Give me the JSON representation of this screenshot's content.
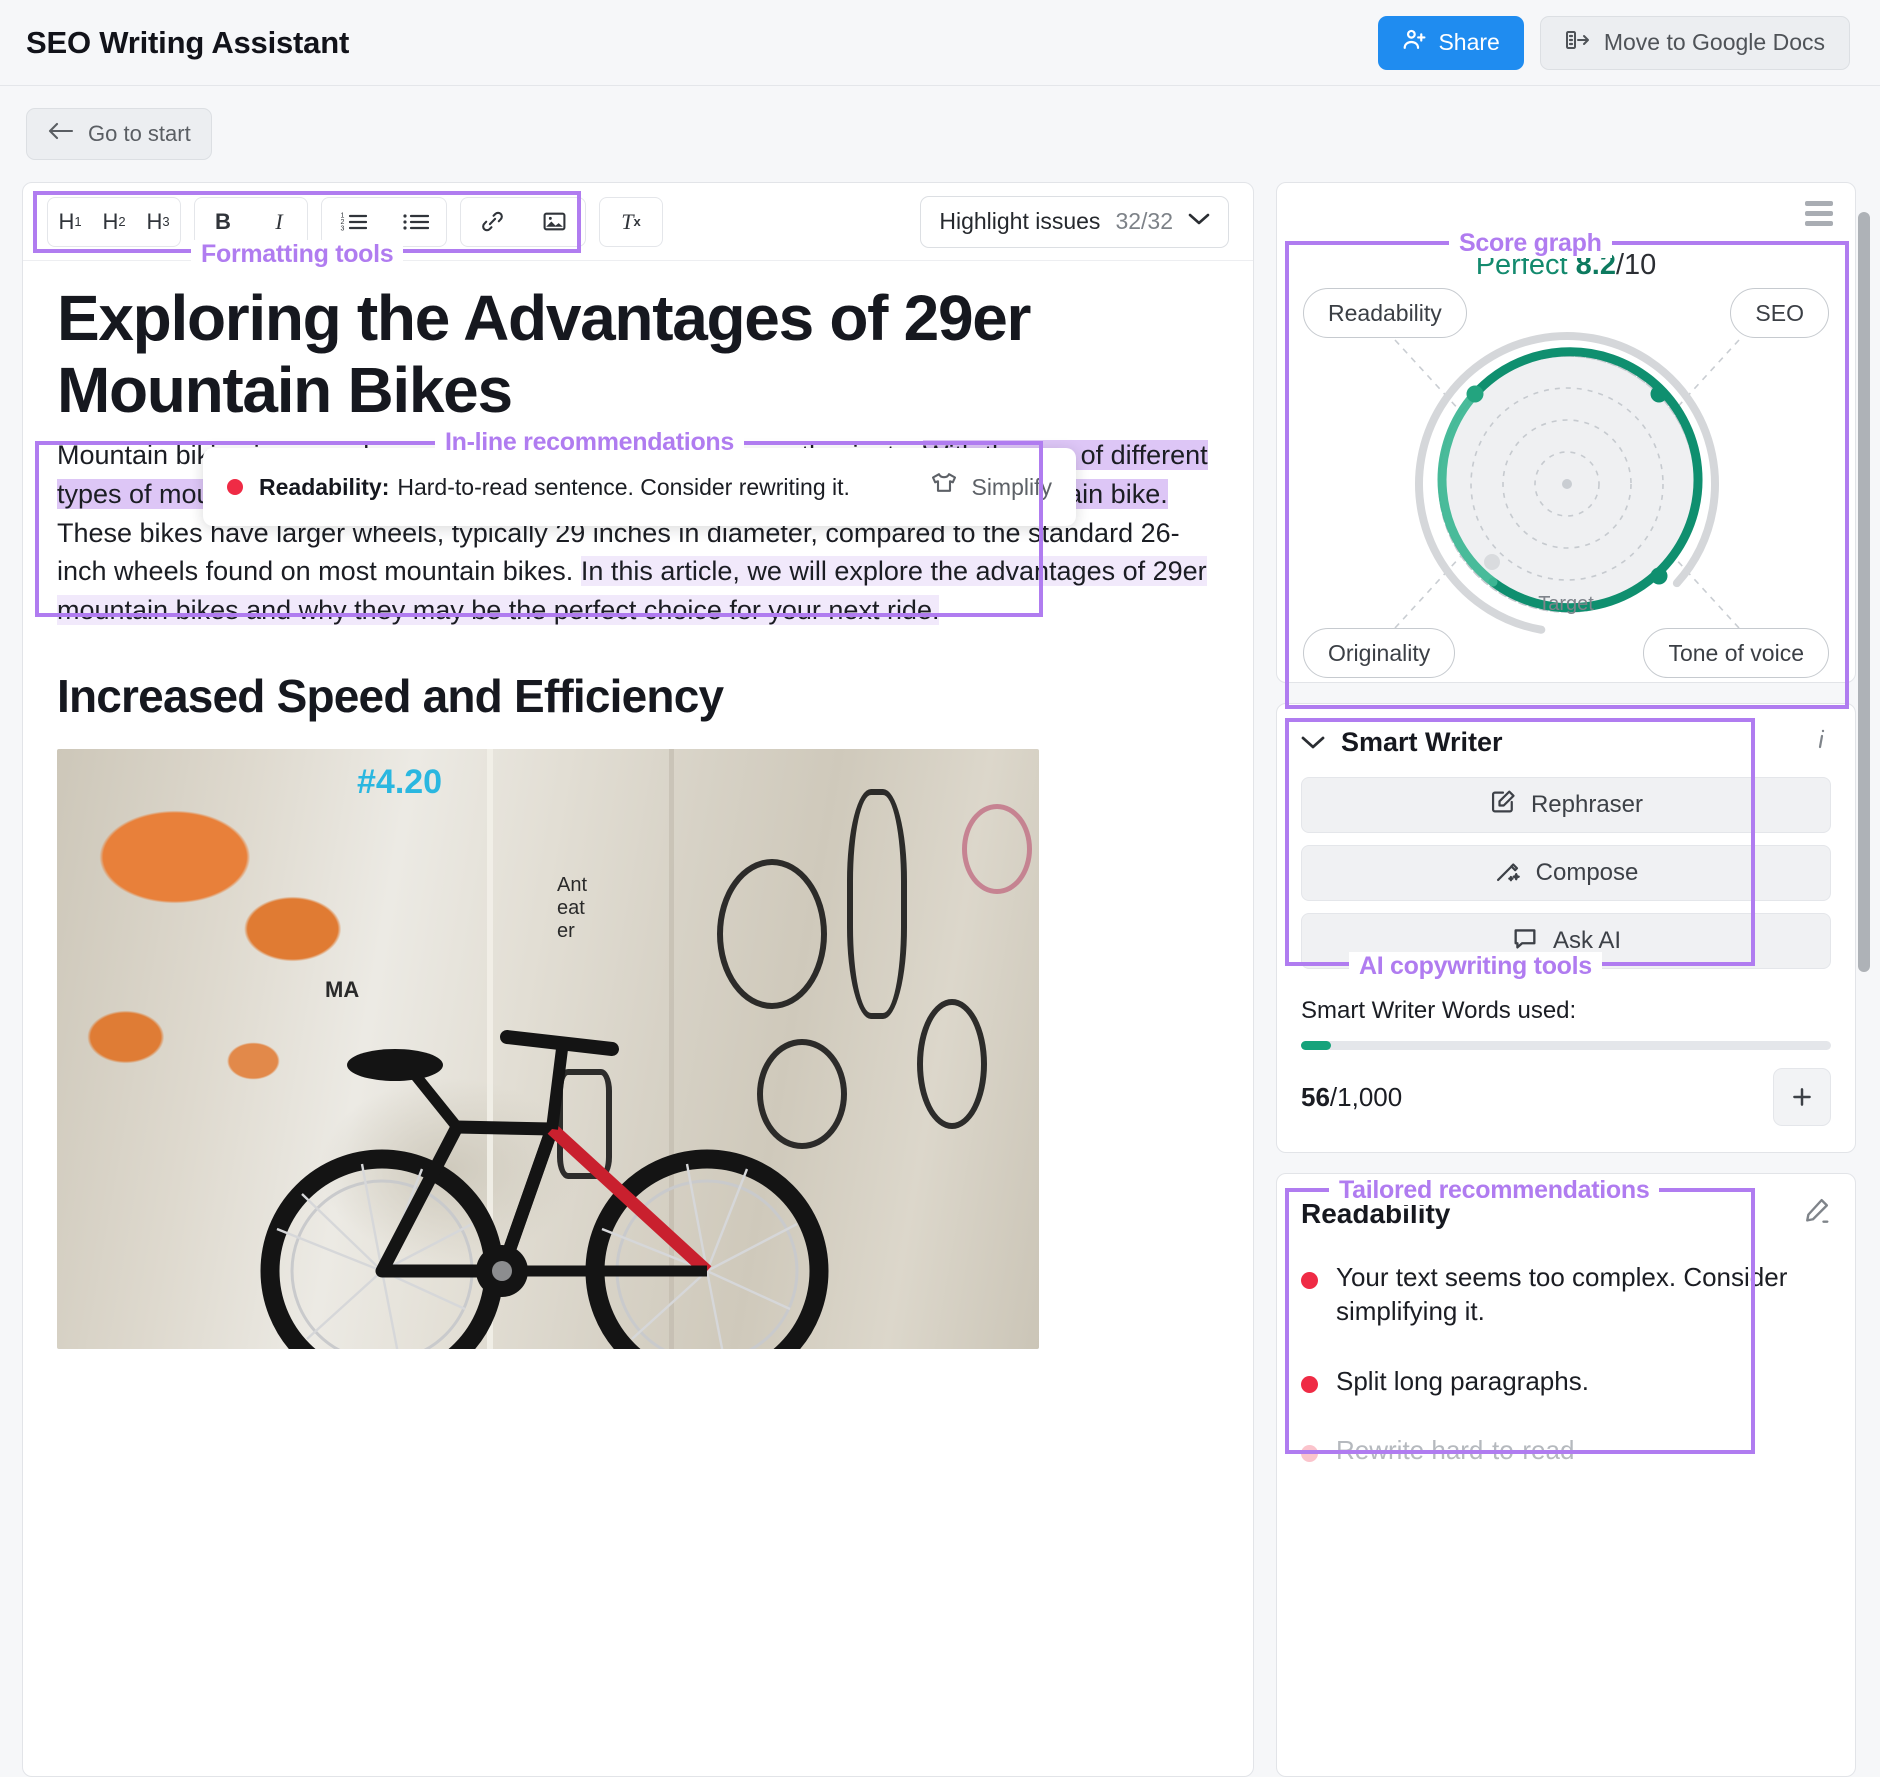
{
  "app": {
    "title": "SEO Writing Assistant"
  },
  "topbar": {
    "share_label": "Share",
    "share_icon": "person-add-icon",
    "docs_label": "Move to Google Docs",
    "docs_icon": "move-to-docs-icon",
    "accent_blue": "#1f8cf0"
  },
  "nav": {
    "back_label": "Go to start",
    "back_icon": "arrow-left-icon"
  },
  "editor": {
    "formatting": {
      "group1": [
        "H1",
        "H2",
        "H3"
      ],
      "group2": [
        "B",
        "I"
      ],
      "group3": [
        "ordered-list-icon",
        "bulleted-list-icon"
      ],
      "group4": [
        "link-icon",
        "image-icon"
      ],
      "group5": [
        "clear-formatting-icon"
      ],
      "h1": "H",
      "h1sub": "1",
      "h2": "H",
      "h2sub": "2",
      "h3": "H",
      "h3sub": "3",
      "bold": "B",
      "italic": "I",
      "clear": "T",
      "clearsub": "x"
    },
    "highlight": {
      "label": "Highlight issues",
      "count": "32/32",
      "chevron": "chevron-down-icon"
    },
    "document": {
      "title": "Exploring the Advantages of 29er Mountain Bikes",
      "p1_a": "Mountain ",
      "p1_hidden": "biking is a popular sport enjoyed by many outdoor",
      "p1_b": "enthusiasts. ",
      "p1_strong": "With the rise of different types of mountain bikes, one type that has gained a lot of attention is the 29er mountain bike.",
      "p1_c": " These bikes have larger wheels, typically 29 inches in diameter, compared to the standard 26-inch wheels found on most mountain bikes. ",
      "p1_soft": "In this article, we will explore the advantages of 29er mountain bikes and why they may be the perfect choice for your next ride.",
      "h2": "Increased Speed and Efficiency",
      "photo_alt": "mountain-bike-against-graffiti-wall-photo"
    },
    "recommendation": {
      "category": "Readability:",
      "message": "Hard-to-read sentence. Consider rewriting it.",
      "action_label": "Simplify",
      "action_icon": "simplify-shirt-icon",
      "dot_color": "#ef2b45"
    }
  },
  "sidebar": {
    "menu_icon": "hamburger-menu-icon",
    "score": {
      "status": "Perfect",
      "value": "8.2",
      "denominator": "/10",
      "target_label": "Target",
      "metrics": [
        "Readability",
        "SEO",
        "Originality",
        "Tone of voice"
      ],
      "accent_green": "#0f8f6f"
    },
    "smart_writer": {
      "title": "Smart Writer",
      "chevron": "chevron-down-icon",
      "info_icon": "info-icon",
      "buttons": [
        {
          "label": "Rephraser",
          "icon": "edit-square-icon"
        },
        {
          "label": "Compose",
          "icon": "magic-wand-icon"
        },
        {
          "label": "Ask AI",
          "icon": "chat-bubble-icon"
        }
      ],
      "words_label": "Smart Writer Words used:",
      "used": "56",
      "limit": "/1,000",
      "progress_percent": 5.6,
      "add_icon": "plus-icon"
    },
    "tailored": {
      "title": "Readability",
      "edit_icon": "pencil-icon",
      "items": [
        {
          "text": "Your text seems too complex. Consider simplifying it.",
          "faded": false
        },
        {
          "text": "Split long paragraphs.",
          "faded": false
        },
        {
          "text": "Rewrite hard-to-read",
          "faded": true
        }
      ]
    },
    "scrollbar": "vertical-scrollbar"
  },
  "annotations": {
    "color": "#b07cf0",
    "formatting_tools": "Formatting tools",
    "inline_recommendations": "In-line recommendations",
    "score_graph": "Score graph",
    "ai_copywriting_tools": "AI copywriting tools",
    "tailored_recommendations": "Tailored recommendations"
  },
  "chart_data": {
    "type": "radar",
    "title": "Score graph",
    "categories": [
      "Readability",
      "SEO",
      "Tone of voice",
      "Originality"
    ],
    "values": [
      8.2,
      9.5,
      9.0,
      6.0
    ],
    "target": 8.0,
    "overall_score": 8.2,
    "scale_max": 10,
    "status_text": "Perfect",
    "legend": [
      "Target"
    ],
    "grid": true
  }
}
